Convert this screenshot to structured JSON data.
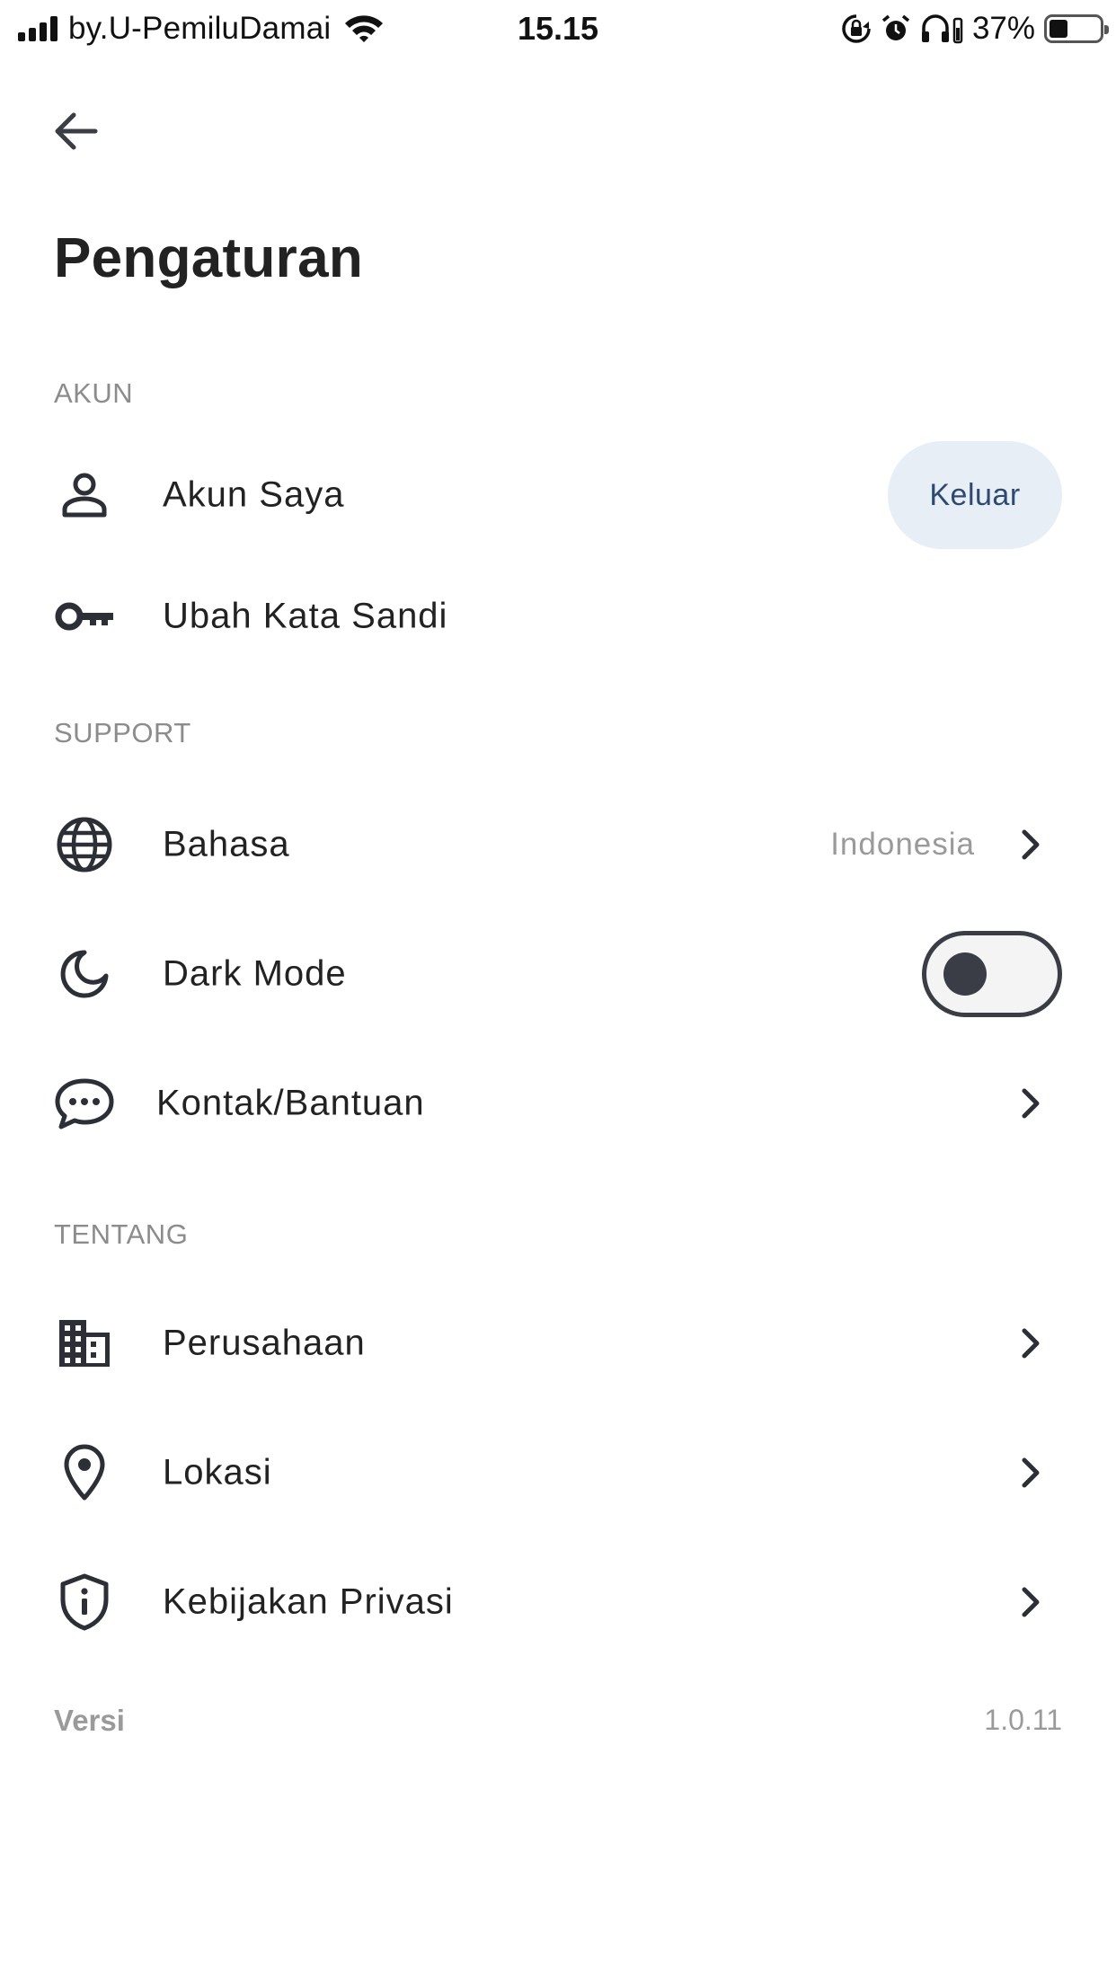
{
  "status_bar": {
    "carrier": "by.U-PemiluDamai",
    "time": "15.15",
    "battery": "37%",
    "battery_level": 0.37,
    "icons": [
      "signal-icon",
      "wifi-icon",
      "rotation-lock-icon",
      "alarm-icon",
      "headphones-icon",
      "battery-icon"
    ]
  },
  "header": {
    "back_icon": "arrow-left-icon",
    "title": "Pengaturan"
  },
  "sections": {
    "account": {
      "title": "AKUN",
      "my_account": {
        "label": "Akun Saya",
        "icon": "person-icon",
        "logout_label": "Keluar"
      },
      "change_password": {
        "label": "Ubah Kata Sandi",
        "icon": "key-icon"
      }
    },
    "support": {
      "title": "SUPPORT",
      "language": {
        "label": "Bahasa",
        "value": "Indonesia",
        "icon": "globe-icon"
      },
      "dark_mode": {
        "label": "Dark Mode",
        "icon": "moon-icon",
        "enabled": false
      },
      "contact": {
        "label": "Kontak/Bantuan",
        "icon": "chat-bubble-icon"
      }
    },
    "about": {
      "title": "TENTANG",
      "company": {
        "label": "Perusahaan",
        "icon": "building-icon"
      },
      "location": {
        "label": "Lokasi",
        "icon": "location-pin-icon"
      },
      "privacy": {
        "label": "Kebijakan Privasi",
        "icon": "shield-info-icon"
      }
    }
  },
  "footer": {
    "version_label": "Versi",
    "version_value": "1.0.11"
  },
  "colors": {
    "accent_bg": "#e8eef5",
    "accent_text": "#2e4a70",
    "section_title": "#8c8c8c",
    "toggle": "#3a3d45"
  }
}
